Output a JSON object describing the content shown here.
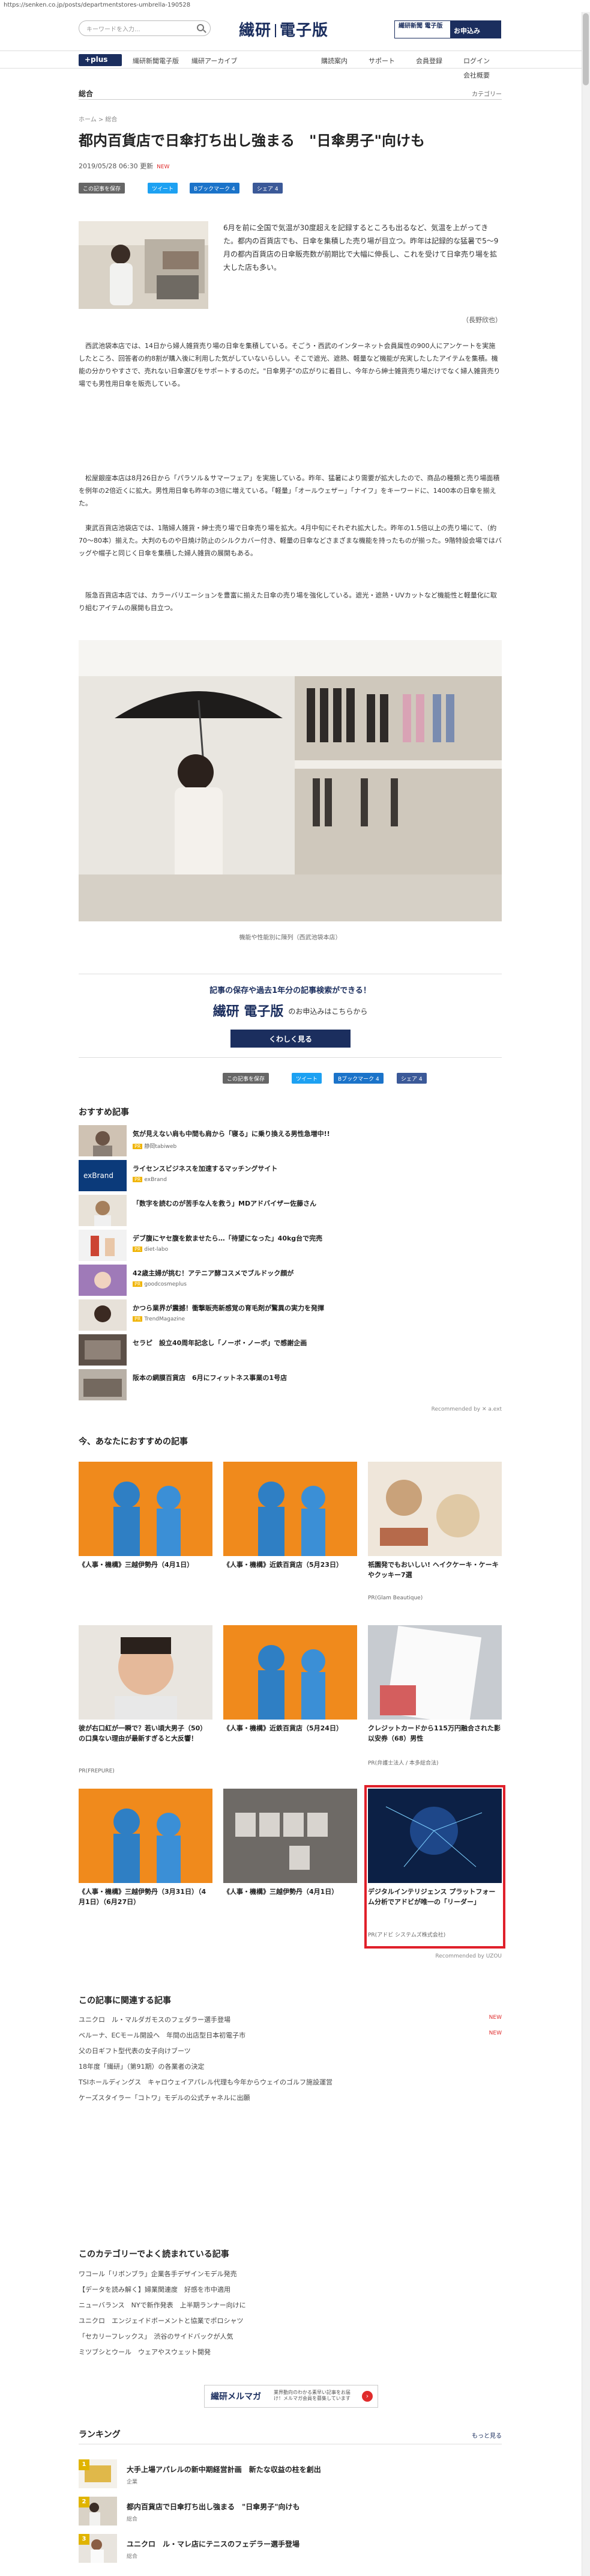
{
  "url": "https://senken.co.jp/posts/departmentstores-umbrella-190528",
  "header": {
    "search_placeholder": "キーワードを入力...",
    "logo_left": "繊研",
    "logo_right": "電子版",
    "promo_left": "繊研新聞 電子版",
    "promo_right": "お申込み"
  },
  "nav": {
    "plus": "+plus",
    "items": [
      "繊研新聞電子版",
      "繊研アーカイブ",
      "購読案内",
      "サポート",
      "会員登録",
      "ログイン"
    ],
    "company": "会社概要"
  },
  "section": {
    "label": "総合",
    "category_link": "カテゴリー"
  },
  "breadcrumb": "ホーム > 総合",
  "article": {
    "title": "都内百貨店で日傘打ち出し強まる　\"日傘男子\"向けも",
    "date": "2019/05/28 06:30 更新",
    "new_badge": "NEW",
    "share": {
      "save": "この記事を保存",
      "tweet": "ツイート",
      "bookmark": "Bブックマーク 4",
      "facebook": "シェア 4"
    },
    "lead": "6月を前に全国で気温が30度超えを記録するところも出るなど、気温を上がってきた。都内の百貨店でも、日傘を集積した売り場が目立つ。昨年は記録的な猛暑で5〜9月の都内百貨店の日傘販売数が前期比で大幅に伸長し、これを受けて日傘売り場を拡大した店も多い。",
    "byline": "（長野欣也）",
    "paragraphs": [
      "西武池袋本店では、14日から婦人雑貨売り場の日傘を集積している。そごう・西武のインターネット会員属性の900人にアンケートを実施したところ、回答者の約8割が購入後に利用した気がしていないらしい。そこで遮光、遮熱、軽量など機能が充実したしたアイテムを集積。機能の分かりやすさで、売れない日傘選びをサポートするのだ。\"日傘男子\"の広がりに着目し、今年から紳士雑貨売り場だけでなく婦人雑貨売り場でも男性用日傘を販売している。",
      "松屋銀座本店は8月26日から「パラソル＆サマーフェア」を実施している。昨年、猛暑により需要が拡大したので、商品の種類と売り場面積を例年の2倍近くに拡大。男性用日傘も昨年の3倍に増えている。「軽量」「オールウェザー」「ナイフ」をキーワードに、1400本の日傘を揃えた。",
      "東武百貨店池袋店では、1階婦人雑貨・紳士売り場で日傘売り場を拡大。4月中旬にそれぞれ拡大した。昨年の1.5倍以上の売り場にて、（約70〜80本）揃えた。大判のものや日焼け防止のシルクカバー付き、軽量の日傘などさまざまな機能を持ったものが揃った。9階特設会場ではバッグや帽子と同じく日傘を集積した婦人雑貨の展開もある。",
      "阪急百貨店本店では、カラーバリエーションを豊富に揃えた日傘の売り場を強化している。遮光・遮熱・UVカットなど機能性と軽量化に取り組むアイテムの展開も目立つ。"
    ],
    "photo_caption": "機能や性能別に陳列（西武池袋本店）"
  },
  "register": {
    "line1": "記事の保存や過去1年分の記事検索ができる！",
    "line2_logo": "繊研 電子版",
    "line2": "のお申込みはこちらから",
    "button": "くわしく見る"
  },
  "recommended": {
    "title": "おすすめ記事",
    "credit": "Recommended by ✕ a.ext",
    "items": [
      {
        "text": "気が見えない肩も中間も肩から「寝る」に乗り換える男性急増中!!",
        "src": "静岡tabiweb",
        "pr": false
      },
      {
        "text": "ライセンスビジネスを加速するマッチングサイト",
        "src": "exBrand",
        "pr": true
      },
      {
        "text": "「数字を読むのが苦手な人を救う」MDアドバイザー佐藤さん",
        "src": "",
        "pr": false
      },
      {
        "text": "デブ腹にヤセ腹を飲ませたら…「待望になった」40kg台で完売",
        "src": "diet-labo",
        "pr": true
      },
      {
        "text": "42歳主婦が挑む！アテニア酵コスメでブルドック顔が",
        "src": "goodcosmeplus",
        "pr": true
      },
      {
        "text": "かつら業界が震撼！衝撃販売新感覚の育毛剤が驚異の実力を発揮",
        "src": "TrendMagazine",
        "pr": true
      },
      {
        "text": "セラピ　設立40周年記念し「ノーボ・ノーボ」で感謝企画",
        "src": "",
        "pr": false
      },
      {
        "text": "阪本の網膜百貨店　6月にフィットネス事業の1号店",
        "src": "",
        "pr": false
      }
    ]
  },
  "uzou": {
    "title": "今、あなたにおすすめの記事",
    "credit": "Recommended by UZOU",
    "cards": [
      {
        "title": "《人事・機構》三越伊勢丹（4月1日）",
        "src": ""
      },
      {
        "title": "《人事・機構》近鉄百貨店（5月23日）",
        "src": ""
      },
      {
        "title": "祇園発でもおいしい! ヘイクケーキ・ケーキやクッキー7選",
        "src": "PR(Glam Beautique)"
      },
      {
        "title": "彼が右口紅が一瞬で？若い頃大男子（50）の口臭ない理由が最新すぎると大反響！",
        "src": "PR(FREPURE)"
      },
      {
        "title": "《人事・機構》近鉄百貨店（5月24日）",
        "src": ""
      },
      {
        "title": "クレジットカードから115万円融合された影以安券（68）男性",
        "src": "PR(弁護士法人 / 本多総合法)"
      },
      {
        "title": "《人事・機構》三越伊勢丹（3月31日）（4月1日）（6月27日）",
        "src": ""
      },
      {
        "title": "《人事・機構》三越伊勢丹（4月1日）",
        "src": ""
      },
      {
        "title": "デジタルインテリジェンス プラットフォーム分析でアドビが唯一の「リーダー」",
        "src": "PR(アドビ システムズ株式会社)"
      }
    ]
  },
  "related": {
    "title": "この記事に関連する記事",
    "items": [
      {
        "text": "ユニクロ　ル・マルダガモスのフェダラー選手登場",
        "new": "NEW"
      },
      {
        "text": "ベルーナ、ECモール開設へ　年間の出店型日本初電子市",
        "new": "NEW"
      },
      {
        "text": "父の日ギフト型代表の女子向けブーツ",
        "new": ""
      },
      {
        "text": "18年度「繊研」（第91期）の各業者の決定",
        "new": ""
      },
      {
        "text": "TSIホールディングス　キャロウェイアパレル代理も今年からウェイのゴルフ施設運営",
        "new": ""
      },
      {
        "text": "ケーズスタイラー「コトワ」モデルの公式チャネルに出願",
        "new": ""
      }
    ]
  },
  "category_reads": {
    "title": "このカテゴリーでよく読まれている記事",
    "items": [
      "ワコール「リボンブラ」企業各手デザインモデル発売",
      "【データを読み解く】婦業関連度　好感を市中適用",
      "ニューバランス　NYで新作発表　上半期ランナー向けに",
      "ユニクロ　エンジェイドボーメントと協業でポロシャツ",
      "「セカリーフレックス」　渋谷のサイドバックが人気",
      "ミツブシとウール　ウェアやスウェット開発"
    ]
  },
  "mail": {
    "title": "繊研メルマガ",
    "desc": "業界動向のわかる素早い記事をお届け！メルマガ会員を募集しています",
    "arrow": "›"
  },
  "ranking": {
    "title": "ランキング",
    "more": "もっと見る",
    "items": [
      {
        "no": "1",
        "text": "大手上場アパレルの新中期経営計画　新たな収益の柱を創出",
        "cat": "企業"
      },
      {
        "no": "2",
        "text": "都内百貨店で日傘打ち出し強まる　\"日傘男子\"向けも",
        "cat": "総合"
      },
      {
        "no": "3",
        "text": "ユニクロ　ル・マレ店にテニスのフェデラー選手登場",
        "cat": "総合"
      }
    ]
  },
  "colors": {
    "brand_navy": "#1b2e5e",
    "twitter": "#1da1f2",
    "facebook": "#3b5998",
    "highlight": "#e0202a",
    "new": "#e02c2c"
  }
}
